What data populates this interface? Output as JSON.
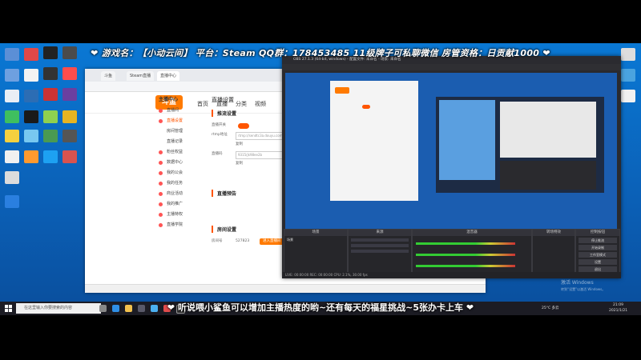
{
  "top_banner": "❤ 游戏名：【小动云间】 平台：Steam QQ群：178453485 11级牌子可私聊微信 房管资格：日贡献1000 ❤",
  "bottom_banner": "❤ 听说喂小鲨鱼可以增加主播热度的哟~还有每天的福星挑战~5张办卡上车 ❤",
  "browser": {
    "tabs": [
      "斗鱼",
      "Steam直播",
      "直播中心"
    ],
    "site_logo": "斗鱼",
    "nav": [
      "首页",
      "直播",
      "分类",
      "视频"
    ],
    "sidebar_header": "主播中心",
    "sidebar_items": [
      "直播间",
      "直播设置",
      "房间管理",
      "直播记录",
      "粉丝权益",
      "数据中心",
      "我的公会",
      "我的任务",
      "商业活动",
      "我的推广",
      "主播特权",
      "直播学院"
    ],
    "active_index": 1,
    "page_title": "直播设置",
    "section_push": "推流设置",
    "toggle_label": "直播开关",
    "push_url_label": "rtmp地址",
    "push_url": "rtmp://sendtc3a.douyu.com",
    "copy_label": "复制",
    "stream_code_label": "直播码",
    "stream_code": "9315/jk98ee2b",
    "section_notice": "直播预告",
    "section_room": "房间设置",
    "room_label": "房间号",
    "room_value": "527823",
    "room_button": "进入直播间"
  },
  "obs": {
    "title": "OBS 27.1.3 (64-bit, windows) - 配置文件: 未命名 - 场景: 未命名",
    "panels": [
      "场景",
      "来源",
      "混音器",
      "转场特效",
      "控制按钮"
    ],
    "scene_item": "场景",
    "controls": [
      "停止推流",
      "开始录制",
      "工作室模式",
      "设置",
      "退出"
    ],
    "status": "LIVE: 00:00:00 REC: 00:00:00 CPU: 2.1%, 30.00 fps"
  },
  "taskbar": {
    "search_placeholder": "在这里输入你要搜索的内容",
    "time": "21:09",
    "date": "2021/1/21",
    "weather": "25°C 多云"
  },
  "watermark": {
    "line1": "激活 Windows",
    "line2": "转到“设置”以激活 Windows。"
  },
  "colors": {
    "accent": "#ff7a00",
    "obs_bg": "#2a2a2e",
    "desktop": "#0a78d4"
  }
}
